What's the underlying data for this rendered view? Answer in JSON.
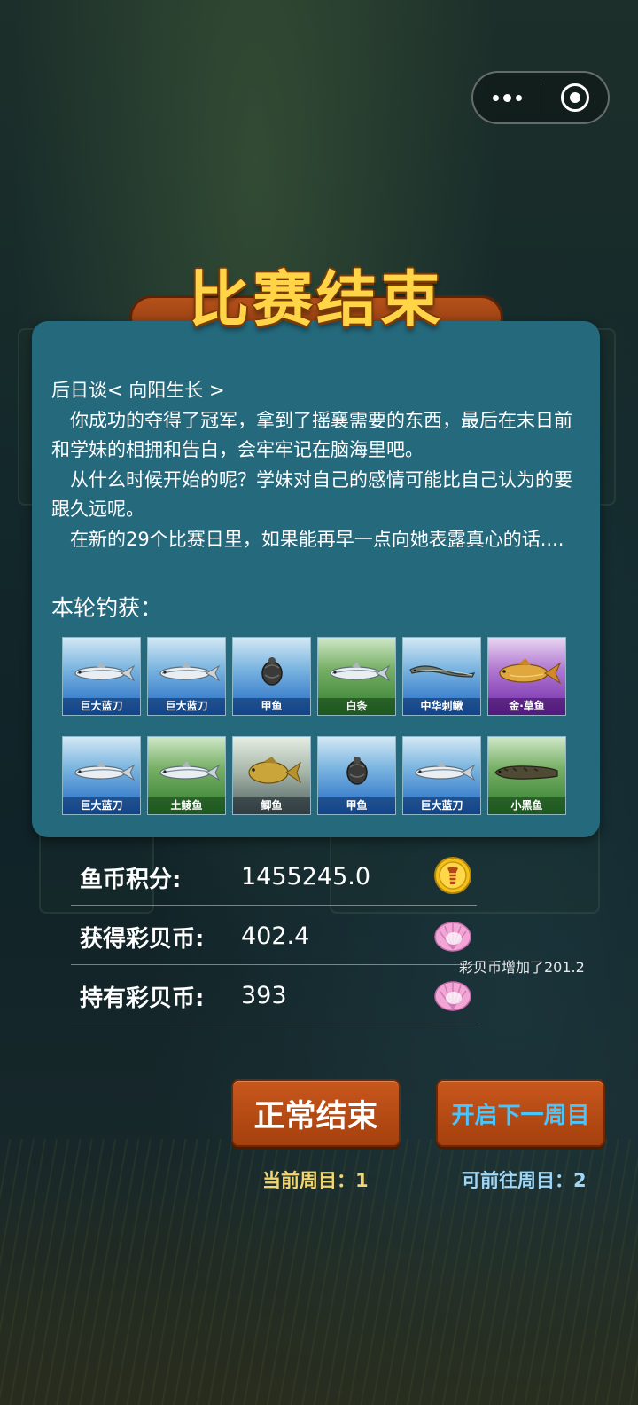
{
  "title": "比赛结束",
  "story": {
    "heading": "后日谈< 向阳生长 >",
    "paragraphs": [
      "你成功的夺得了冠军，拿到了摇襄需要的东西，最后在末日前和学妹的相拥和告白，会牢牢记在脑海里吧。",
      "从什么时候开始的呢？学妹对自己的感情可能比自己认为的要跟久远呢。",
      "在新的29个比赛日里，如果能再早一点向她表露真心的话...."
    ]
  },
  "catch": {
    "label": "本轮钓获：",
    "fish": [
      {
        "name": "巨大蓝刀",
        "bg": "blue",
        "icon": "silver-fish-icon"
      },
      {
        "name": "巨大蓝刀",
        "bg": "blue",
        "icon": "silver-fish-icon"
      },
      {
        "name": "甲鱼",
        "bg": "blue",
        "icon": "turtle-icon"
      },
      {
        "name": "白条",
        "bg": "green",
        "icon": "silver-fish-icon"
      },
      {
        "name": "中华刺鳅",
        "bg": "blue",
        "icon": "eel-icon"
      },
      {
        "name": "金·草鱼",
        "bg": "purple",
        "icon": "golden-fish-icon"
      },
      {
        "name": "巨大蓝刀",
        "bg": "blue",
        "icon": "silver-fish-icon"
      },
      {
        "name": "土鲮鱼",
        "bg": "green",
        "icon": "silver-fish-icon"
      },
      {
        "name": "鲫鱼",
        "bg": "gray",
        "icon": "carp-icon"
      },
      {
        "name": "甲鱼",
        "bg": "blue",
        "icon": "turtle-icon"
      },
      {
        "name": "巨大蓝刀",
        "bg": "blue",
        "icon": "silver-fish-icon"
      },
      {
        "name": "小黑鱼",
        "bg": "green",
        "icon": "snakehead-icon"
      }
    ]
  },
  "stats": {
    "fish_coins_label": "鱼币积分:",
    "fish_coins_value": "1455245.0",
    "earned_shell_label": "获得彩贝币:",
    "earned_shell_value": "402.4",
    "held_shell_label": "持有彩贝币:",
    "held_shell_value": "393",
    "shell_increase_note": "彩贝币增加了201.2"
  },
  "buttons": {
    "end_label": "正常结束",
    "next_label": "开启下一周目"
  },
  "rounds": {
    "current": "当前周目：1",
    "available": "可前往周目：2"
  },
  "colors": {
    "card": "#25697d",
    "title": "#ffd447",
    "button": "#b34a14",
    "next_text": "#45c6ff"
  }
}
